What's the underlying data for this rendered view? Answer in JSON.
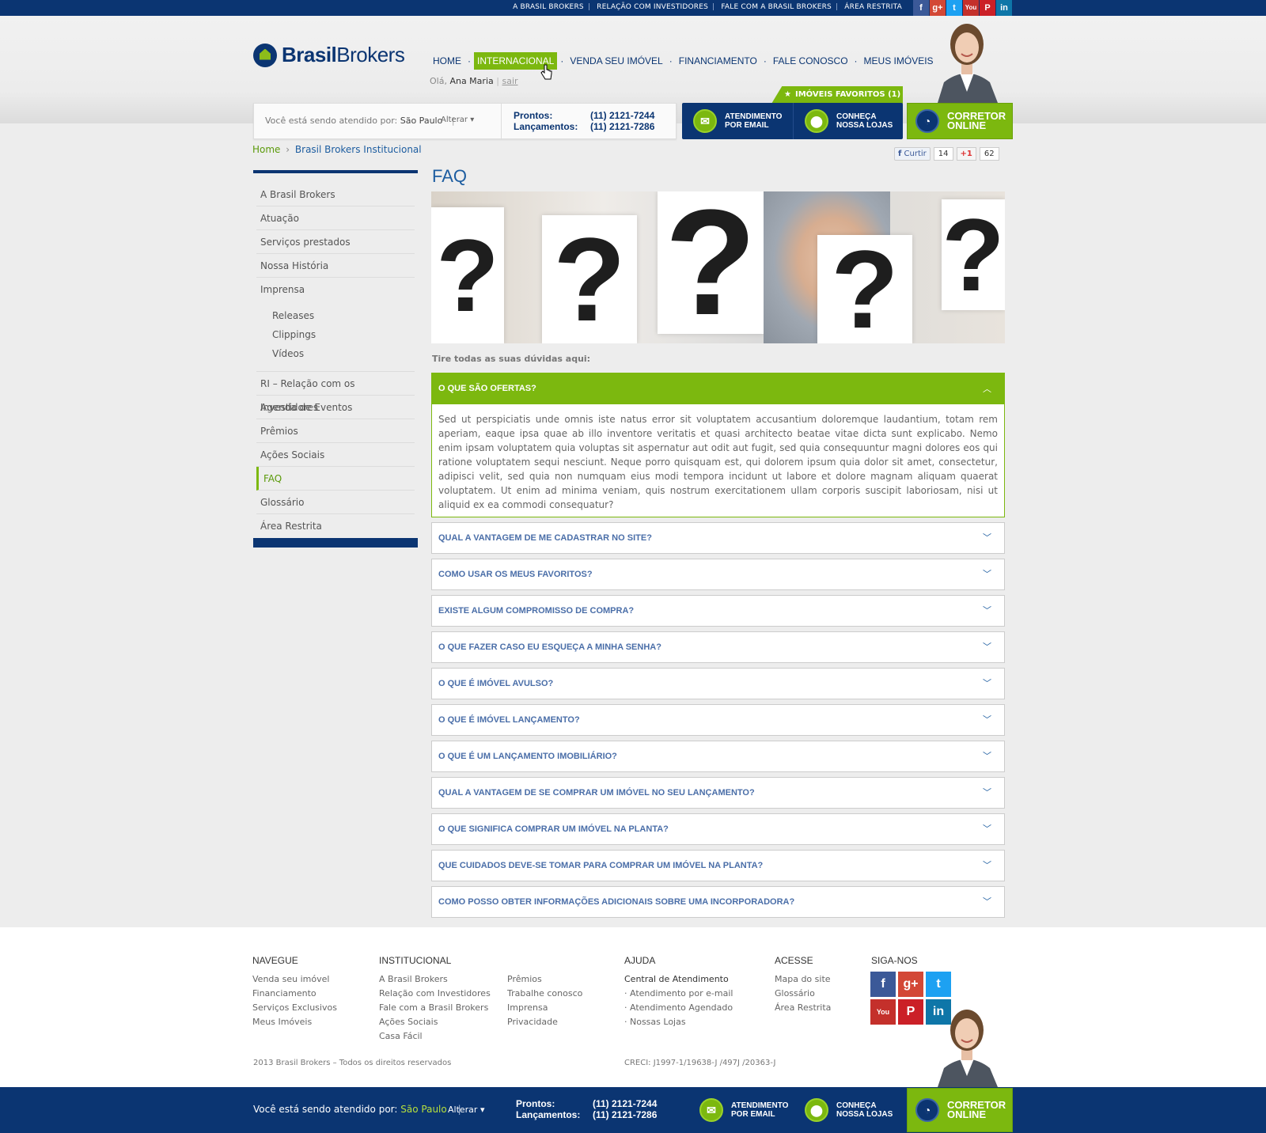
{
  "topbar": {
    "links": [
      "A BRASIL BROKERS",
      "RELAÇÃO COM INVESTIDORES",
      "FALE COM A BRASIL BROKERS",
      "ÁREA RESTRITA"
    ]
  },
  "header": {
    "logo_bold": "Brasil",
    "logo_light": "Brokers",
    "nav": [
      "HOME",
      "INTERNACIONAL",
      "VENDA SEU IMÓVEL",
      "FINANCIAMENTO",
      "FALE CONOSCO",
      "MEUS IMÓVEIS"
    ],
    "active_nav": "INTERNACIONAL",
    "greeting": "Olá,",
    "user_name": "Ana Maria",
    "logout": "sair",
    "favorites": "IMÓVEIS FAVORITOS (1)",
    "attending_label": "Você está sendo atendido por:",
    "attending_city": "São Paulo",
    "change": "Alterar",
    "phone_labels": [
      "Prontos:",
      "Lançamentos:"
    ],
    "phone_numbers": [
      "(11) 2121-7244",
      "(11) 2121-7286"
    ],
    "btn_email": [
      "ATENDIMENTO",
      "POR EMAIL"
    ],
    "btn_stores": [
      "CONHEÇA",
      "NOSSA LOJAS"
    ],
    "btn_broker": [
      "CORRETOR",
      "ONLINE"
    ]
  },
  "breadcrumb": {
    "home": "Home",
    "current": "Brasil Brokers Institucional"
  },
  "social_counts": {
    "fb_label": "Curtir",
    "fb_count": "14",
    "gplus_label": "+1",
    "gplus_count": "62"
  },
  "sidebar": {
    "items_top": [
      "A Brasil Brokers",
      "Atuação",
      "Serviços prestados",
      "Nossa História",
      "Imprensa"
    ],
    "sub_items": [
      "Releases",
      "Clippings",
      "Vídeos"
    ],
    "items_bottom": [
      "RI – Relação com os Investidores",
      "Agenda de Eventos",
      "Prêmios",
      "Ações Sociais",
      "FAQ",
      "Glossário",
      "Área Restrita"
    ],
    "active": "FAQ"
  },
  "content": {
    "title": "FAQ",
    "intro": "Tire todas as suas dúvidas aqui:",
    "faqs": [
      {
        "q": "O QUE SÃO OFERTAS?",
        "a": "Sed ut perspiciatis unde omnis iste natus error sit voluptatem accusantium doloremque laudantium, totam rem aperiam, eaque ipsa quae ab illo inventore veritatis et quasi architecto beatae vitae dicta sunt explicabo. Nemo enim ipsam voluptatem quia voluptas sit aspernatur aut odit aut fugit, sed quia consequuntur magni dolores eos qui ratione voluptatem sequi nesciunt. Neque porro quisquam est, qui dolorem ipsum quia dolor sit amet, consectetur, adipisci velit, sed quia non numquam eius modi tempora incidunt ut labore et dolore magnam aliquam quaerat voluptatem. Ut enim ad minima veniam, quis nostrum exercitationem ullam corporis suscipit laboriosam, nisi ut aliquid ex ea commodi consequatur?"
      },
      {
        "q": "QUAL A VANTAGEM DE ME CADASTRAR NO SITE?"
      },
      {
        "q": "COMO USAR OS MEUS FAVORITOS?"
      },
      {
        "q": "EXISTE ALGUM COMPROMISSO DE COMPRA?"
      },
      {
        "q": "O QUE FAZER CASO EU ESQUEÇA A MINHA SENHA?"
      },
      {
        "q": "O QUE É IMÓVEL AVULSO?"
      },
      {
        "q": "O QUE É IMÓVEL LANÇAMENTO?"
      },
      {
        "q": "O QUE É UM LANÇAMENTO IMOBILIÁRIO?"
      },
      {
        "q": "QUAL A VANTAGEM DE SE COMPRAR UM IMÓVEL NO SEU LANÇAMENTO?"
      },
      {
        "q": "O QUE SIGNIFICA COMPRAR UM IMÓVEL NA PLANTA?"
      },
      {
        "q": "QUE CUIDADOS DEVE-SE TOMAR PARA COMPRAR UM IMÓVEL NA PLANTA?"
      },
      {
        "q": "COMO POSSO OBTER INFORMAÇÕES ADICIONAIS SOBRE UMA INCORPORADORA?"
      }
    ]
  },
  "footer": {
    "navegue": {
      "title": "NAVEGUE",
      "links": [
        "Venda seu imóvel",
        "Financiamento",
        "Serviços Exclusivos",
        "Meus Imóveis"
      ]
    },
    "institucional": {
      "title": "INSTITUCIONAL",
      "links_a": [
        "A Brasil Brokers",
        "Relação com Investidores",
        "Fale com a Brasil Brokers",
        "Ações Sociais",
        "Casa Fácil"
      ],
      "links_b": [
        "Prêmios",
        "Trabalhe conosco",
        "Imprensa",
        "Privacidade"
      ]
    },
    "ajuda": {
      "title": "AJUDA",
      "head": "Central de Atendimento",
      "links": [
        "· Atendimento por e-mail",
        "· Atendimento Agendado",
        "· Nossas Lojas"
      ]
    },
    "acesse": {
      "title": "ACESSE",
      "links": [
        "Mapa do site",
        "Glossário",
        "Área Restrita"
      ]
    },
    "siga": {
      "title": "SIGA-NOS"
    },
    "copyright": "2013 Brasil Brokers – Todos os direitos reservados",
    "creci": "CRECI: J1997-1/19638-J /497J /20363-J"
  },
  "colors": {
    "brand_blue": "#0b3572",
    "brand_green": "#7cb80f",
    "link_blue": "#1d5da0"
  }
}
